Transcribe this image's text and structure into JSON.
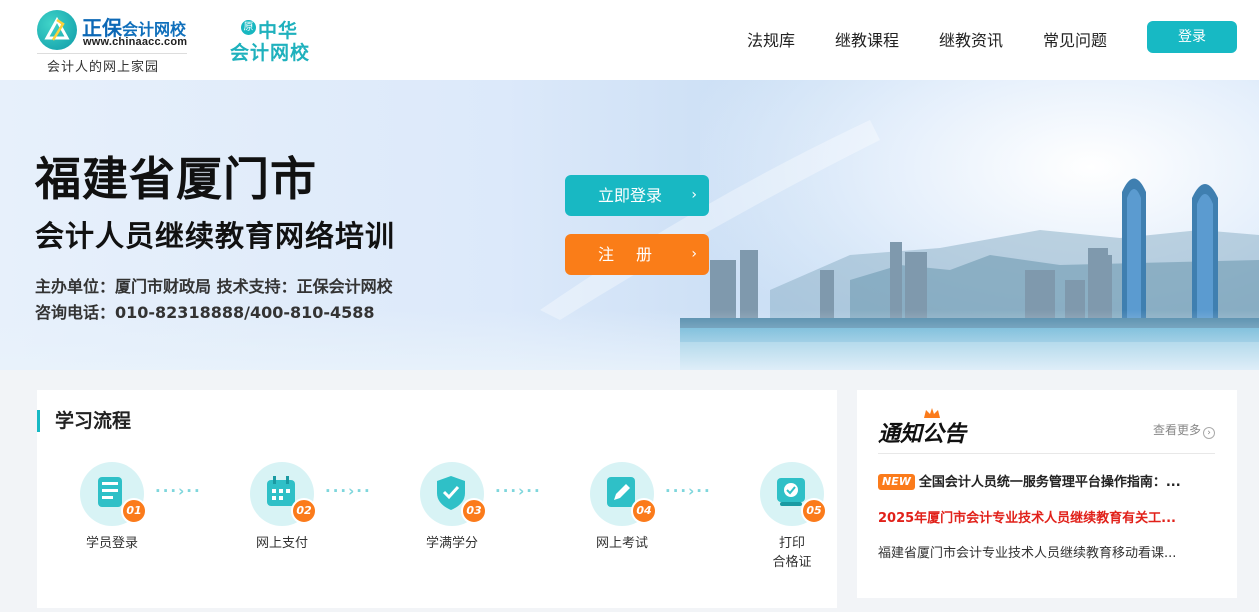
{
  "header": {
    "logo": {
      "brand_prefix": "正保",
      "brand_name": "会计网校",
      "url": "www.chinaacc.com",
      "slogan": "会计人的网上家园"
    },
    "logo2": {
      "badge": "原",
      "line1": "中华",
      "line2": "会计网校"
    },
    "nav": [
      "法规库",
      "继教课程",
      "继教资讯",
      "常见问题"
    ],
    "login_label": "登录"
  },
  "banner": {
    "title": "福建省厦门市",
    "subtitle": "会计人员继续教育网络培训",
    "organizer": "主办单位：厦门市财政局  技术支持：正保会计网校",
    "phone": "咨询电话：010-82318888/400-810-4588",
    "login_button": "立即登录",
    "register_button": "注册",
    "arrow": "›"
  },
  "process": {
    "title": "学习流程",
    "dots": "···›··",
    "steps": [
      {
        "num": "01",
        "label": "学员登录",
        "icon": "document-icon"
      },
      {
        "num": "02",
        "label": "网上支付",
        "icon": "calendar-icon"
      },
      {
        "num": "03",
        "label": "学满学分",
        "icon": "shield-check-icon"
      },
      {
        "num": "04",
        "label": "网上考试",
        "icon": "pencil-icon"
      },
      {
        "num": "05",
        "label": "打印\n合格证",
        "icon": "certificate-icon"
      }
    ]
  },
  "notice": {
    "title": "通知公告",
    "more": "查看更多",
    "new_tag": "NEW",
    "items": [
      "全国会计人员统一服务管理平台操作指南：...",
      "2025年厦门市会计专业技术人员继续教育有关工...",
      "福建省厦门市会计专业技术人员继续教育移动看课..."
    ]
  },
  "colors": {
    "accent_teal": "#17b9c4",
    "accent_orange": "#fb7b1b",
    "headline_red": "#e1211a"
  }
}
